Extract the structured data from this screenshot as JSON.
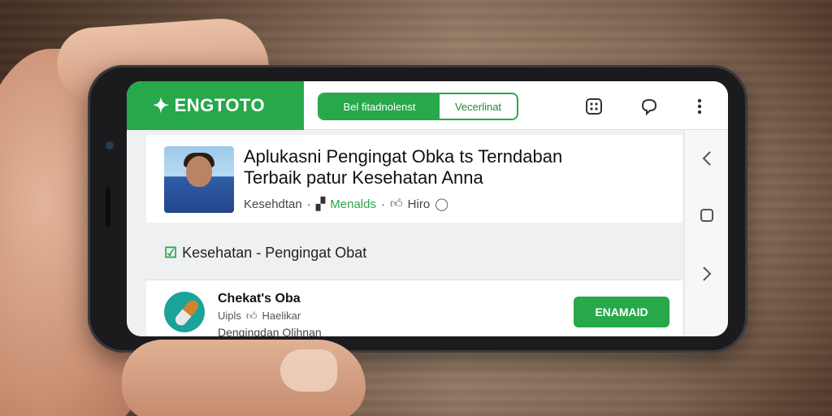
{
  "topbar": {
    "brand": "ENGTOTO",
    "brand_icon": "leaf-logo-icon",
    "segment": [
      "Bel fitadnolenst",
      "Vecerlinat"
    ],
    "icons": [
      "grid-icon",
      "chat-bubble-icon",
      "more-vertical-icon"
    ]
  },
  "sidenav": {
    "icons": [
      "back-chevron-icon",
      "square-icon",
      "forward-chevron-icon"
    ]
  },
  "article": {
    "title_line1": "Aplukasni Pengingat Obka ts Terndaban",
    "title_line2": "Terbaik patur Kesehatan Anna",
    "meta_category": "Kesehdtan",
    "meta_tag": "Menalds",
    "meta_extra": "Hiro"
  },
  "category_row": {
    "label": "Kesehatan - Pengingat Obat"
  },
  "app": {
    "name": "Chekat's Oba",
    "sub_a": "Uipls",
    "sub_b": "Haelikar",
    "desc": "Dengingdan Olihnan",
    "install": "ENAMAID"
  },
  "colors": {
    "accent": "#27a84a"
  }
}
